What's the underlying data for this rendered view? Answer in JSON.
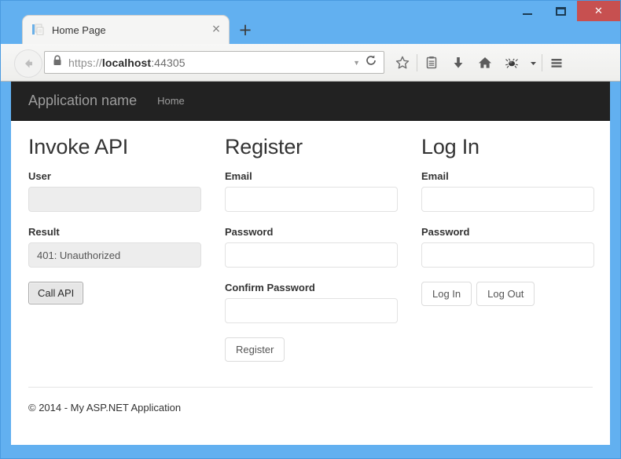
{
  "browser": {
    "window_controls": {
      "minimize": "minimize-button",
      "maximize": "maximize-button",
      "close_label": "✕"
    },
    "tab": {
      "title": "Home Page",
      "close_label": "×",
      "favicon": "document-favicon"
    },
    "new_tab_label": "+",
    "url": {
      "scheme": "https://",
      "host": "localhost",
      "port": ":44305",
      "full": "https://localhost:44305",
      "secure": true
    },
    "toolbar_icons": [
      "bookmark-star-icon",
      "reader-list-icon",
      "download-icon",
      "home-icon",
      "firebug-icon",
      "overflow-caret-icon",
      "hamburger-menu-icon"
    ],
    "chrome_color": "#62b0f0",
    "close_button_color": "#c75050"
  },
  "page": {
    "navbar": {
      "brand": "Application name",
      "links": [
        {
          "label": "Home"
        }
      ],
      "bg_color": "#222222",
      "text_color": "#9d9d9d"
    },
    "columns": [
      {
        "id": "invoke-api",
        "heading": "Invoke API",
        "fields": [
          {
            "id": "user",
            "label": "User",
            "type": "input",
            "value": "",
            "placeholder": "",
            "readonly": true
          },
          {
            "id": "result",
            "label": "Result",
            "type": "static",
            "value": "401: Unauthorized"
          }
        ],
        "buttons": [
          {
            "id": "call-api",
            "label": "Call API",
            "style": "native"
          }
        ]
      },
      {
        "id": "register",
        "heading": "Register",
        "fields": [
          {
            "id": "register-email",
            "label": "Email",
            "type": "input",
            "value": "",
            "placeholder": "",
            "readonly": false
          },
          {
            "id": "register-password",
            "label": "Password",
            "type": "input",
            "value": "",
            "placeholder": "",
            "readonly": false
          },
          {
            "id": "register-confirm-password",
            "label": "Confirm Password",
            "type": "input",
            "value": "",
            "placeholder": "",
            "readonly": false
          }
        ],
        "buttons": [
          {
            "id": "register",
            "label": "Register",
            "style": "bootstrap"
          }
        ]
      },
      {
        "id": "log-in",
        "heading": "Log In",
        "fields": [
          {
            "id": "login-email",
            "label": "Email",
            "type": "input",
            "value": "",
            "placeholder": "",
            "readonly": false
          },
          {
            "id": "login-password",
            "label": "Password",
            "type": "input",
            "value": "",
            "placeholder": "",
            "readonly": false
          }
        ],
        "buttons": [
          {
            "id": "log-in",
            "label": "Log In",
            "style": "bootstrap"
          },
          {
            "id": "log-out",
            "label": "Log Out",
            "style": "bootstrap"
          }
        ]
      }
    ],
    "footer": {
      "text": "© 2014 - My ASP.NET Application"
    }
  }
}
